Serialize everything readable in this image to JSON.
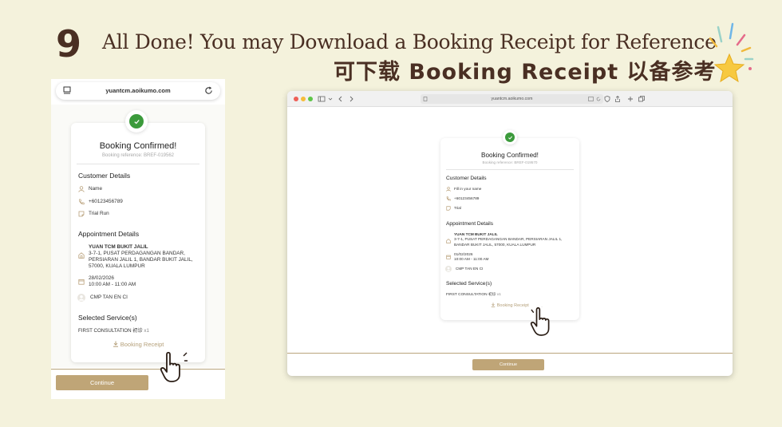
{
  "header": {
    "step_number": "9",
    "title_en": "All Done! You may Download a Booking Receipt for Reference",
    "title_zh": "可下载 Booking Receipt 以备参考"
  },
  "colors": {
    "background": "#f4f2dc",
    "heading": "#4a2f23",
    "accent_gold": "#bfa577",
    "success_green": "#3b9a3b"
  },
  "mobile": {
    "url": "yuantcm.aoikumo.com",
    "title": "Booking Confirmed!",
    "reference": "Booking reference: BREF-019562",
    "customer_heading": "Customer Details",
    "customer_name": "Name",
    "customer_phone": "+60123456789",
    "customer_note": "Trial Run",
    "appointment_heading": "Appointment Details",
    "location_name": "YUAN TCM BUKIT JALIL",
    "location_address": "3-7-1, PUSAT PERDAGANGAN BANDAR, PERSIARAN JALIL 1, BANDAR BUKIT JALIL, 57000, KUALA LUMPUR",
    "date": "28/02/2026",
    "time": "10:00 AM - 11:00 AM",
    "practitioner": "CMP TAN EN CI",
    "services_heading": "Selected Service(s)",
    "service_name": "FIRST CONSULTATION 初诊",
    "service_qty": "x1",
    "receipt_label": "Booking Receipt",
    "continue_label": "Continue"
  },
  "desktop": {
    "url": "yuantcm.aoikumo.com",
    "title": "Booking Confirmed!",
    "reference": "Booking reference: BREF-019570",
    "customer_heading": "Customer Details",
    "customer_name": "Fill in your name",
    "customer_phone": "+60123456789",
    "customer_note": "Trial",
    "appointment_heading": "Appointment Details",
    "location_name": "YUAN TCM BUKIT JALIL",
    "location_address": "3-7-1, PUSAT PERDAGANGAN BANDAR, PERSIARAN JALIL 1, BANDAR BUKIT JALIL, 57000, KUALA LUMPUR",
    "date": "01/02/2026",
    "time": "10:00 AM - 11:00 AM",
    "practitioner": "CMP TAN EN CI",
    "services_heading": "Selected Service(s)",
    "service_name": "FIRST CONSULTATION 初诊",
    "service_qty": "x1",
    "receipt_label": "Booking Receipt",
    "continue_label": "Continue"
  }
}
